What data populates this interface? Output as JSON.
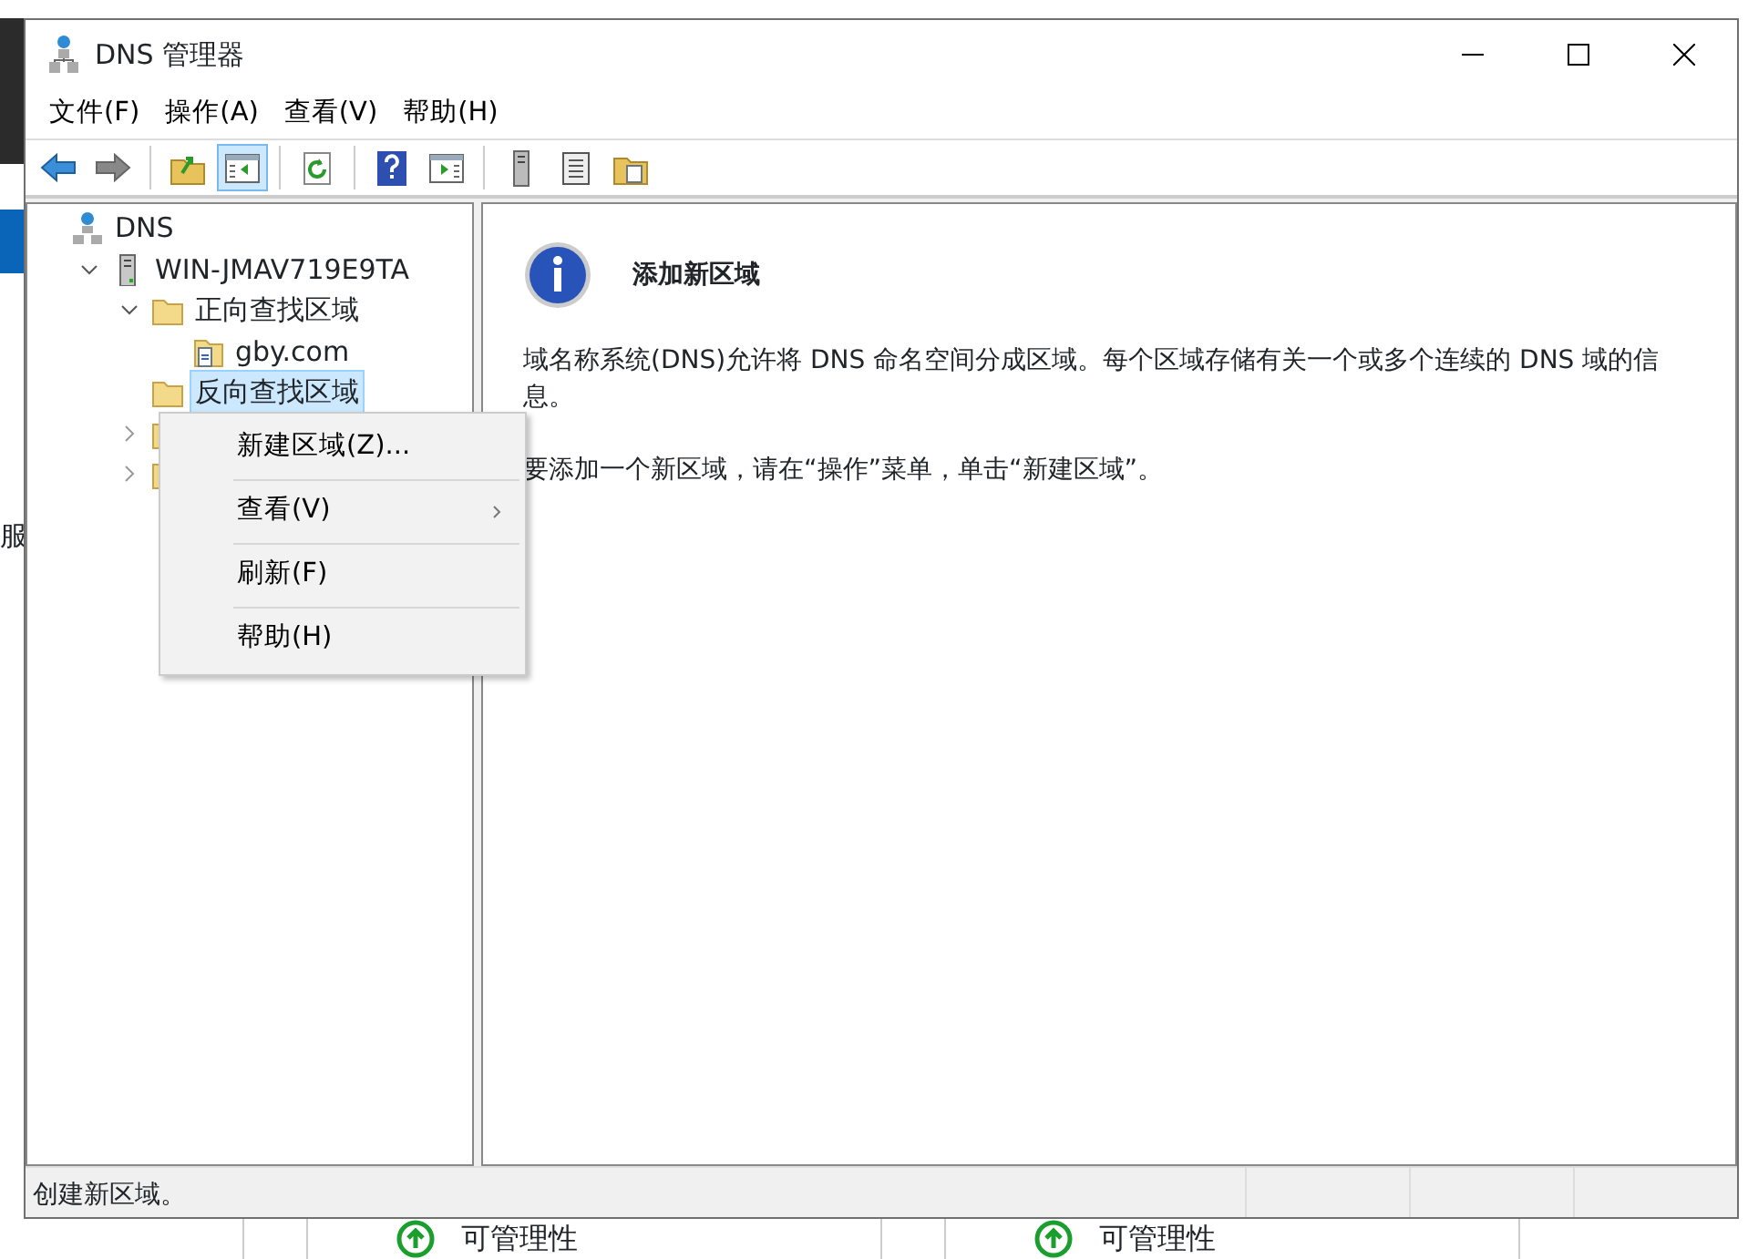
{
  "window": {
    "title": "DNS 管理器"
  },
  "menu_bar": [
    "文件(F)",
    "操作(A)",
    "查看(V)",
    "帮助(H)"
  ],
  "toolbar": [
    {
      "kind": "back"
    },
    {
      "kind": "forward"
    },
    {
      "kind": "separator"
    },
    {
      "kind": "up"
    },
    {
      "kind": "tree",
      "pressed": true
    },
    {
      "kind": "separator"
    },
    {
      "kind": "refresh"
    },
    {
      "kind": "separator"
    },
    {
      "kind": "help"
    },
    {
      "kind": "pane"
    },
    {
      "kind": "separator"
    },
    {
      "kind": "server"
    },
    {
      "kind": "list"
    },
    {
      "kind": "doc"
    }
  ],
  "tree": [
    {
      "label": "DNS",
      "kind": "dns",
      "selected": false,
      "children": [
        {
          "label": "WIN-JMAV719E9TA",
          "kind": "server",
          "expanded": true,
          "selected": false,
          "children": [
            {
              "label": "正向查找区域",
              "kind": "folder",
              "expanded": true,
              "selected": false,
              "children": [
                {
                  "label": "gby.com",
                  "kind": "zone",
                  "selected": false
                }
              ]
            },
            {
              "label": "反向查找区域",
              "kind": "folder",
              "selected": true
            },
            {
              "kind": "folder",
              "expanded": false,
              "selected": false
            },
            {
              "kind": "folder",
              "expanded": false,
              "selected": false
            }
          ]
        }
      ]
    }
  ],
  "context_menu": [
    {
      "label": "新建区域(Z)...",
      "submenu": false
    },
    {
      "label": "查看(V)",
      "submenu": true
    },
    {
      "label": "刷新(F)",
      "submenu": false
    },
    {
      "label": "帮助(H)",
      "submenu": false
    }
  ],
  "detail": {
    "title": "添加新区域",
    "paragraphs": [
      "域名称系统(DNS)允许将 DNS 命名空间分成区域。每个区域存储有关一个或多个连续的 DNS 域的信息。",
      "要添加一个新区域，请在“操作”菜单，单击“新建区域”。"
    ]
  },
  "status_bar": "创建新区域。",
  "background": {
    "side_text": "服",
    "tiles": [
      "可管理性",
      "可管理性"
    ]
  }
}
